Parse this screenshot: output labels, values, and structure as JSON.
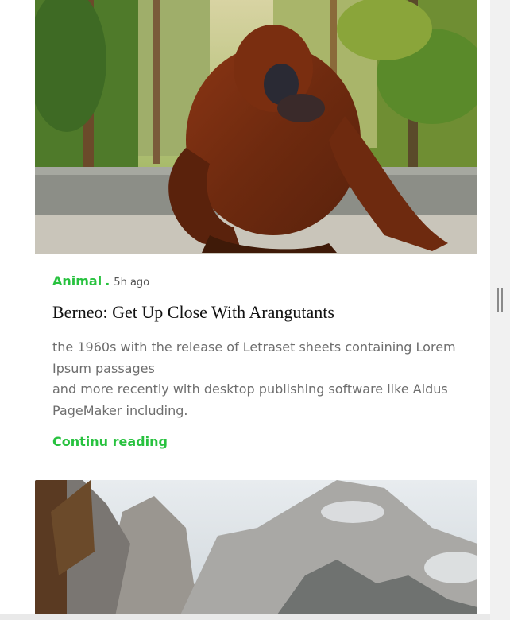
{
  "articles": [
    {
      "category": "Animal",
      "separator": ".",
      "time": "5h ago",
      "title": "Berneo: Get Up Close With Arangutants",
      "excerpt_lines": [
        "the 1960s with the release of Letraset sheets containing Lorem Ipsum passages",
        "and more recently with desktop publishing software like Aldus PageMaker including."
      ],
      "read_more": "Continu reading",
      "image": "orangutan-photo"
    },
    {
      "image": "mountain-photo"
    }
  ],
  "colors": {
    "accent": "#28c23f",
    "title": "#111111",
    "excerpt": "#6e6e6e"
  }
}
